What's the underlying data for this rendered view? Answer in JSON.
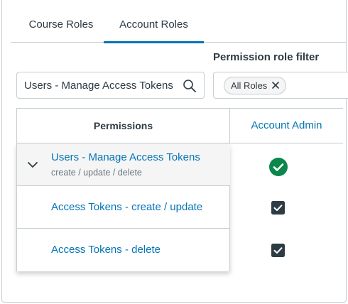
{
  "tabs": [
    {
      "label": "Course Roles",
      "active": false
    },
    {
      "label": "Account Roles",
      "active": true
    }
  ],
  "filter": {
    "label": "Permission role filter",
    "search_value": "Users - Manage Access Tokens",
    "role_tag": "All Roles"
  },
  "table": {
    "permissions_header": "Permissions",
    "role_header": "Account Admin",
    "rows": [
      {
        "title": "Users - Manage Access Tokens",
        "subtitle": "create / update / delete",
        "expanded": true,
        "state": "enabled-circle"
      },
      {
        "title": "Access Tokens - create / update",
        "state": "checked-box"
      },
      {
        "title": "Access Tokens - delete",
        "state": "checked-box"
      }
    ]
  },
  "colors": {
    "link": "#0374b5",
    "success": "#0b874b",
    "checkbox": "#2d3b45",
    "border": "#c7cdd1"
  },
  "icons": [
    "search-icon",
    "close-icon",
    "chevron-down-icon",
    "check-circle-icon",
    "checkbox-checked-icon"
  ]
}
